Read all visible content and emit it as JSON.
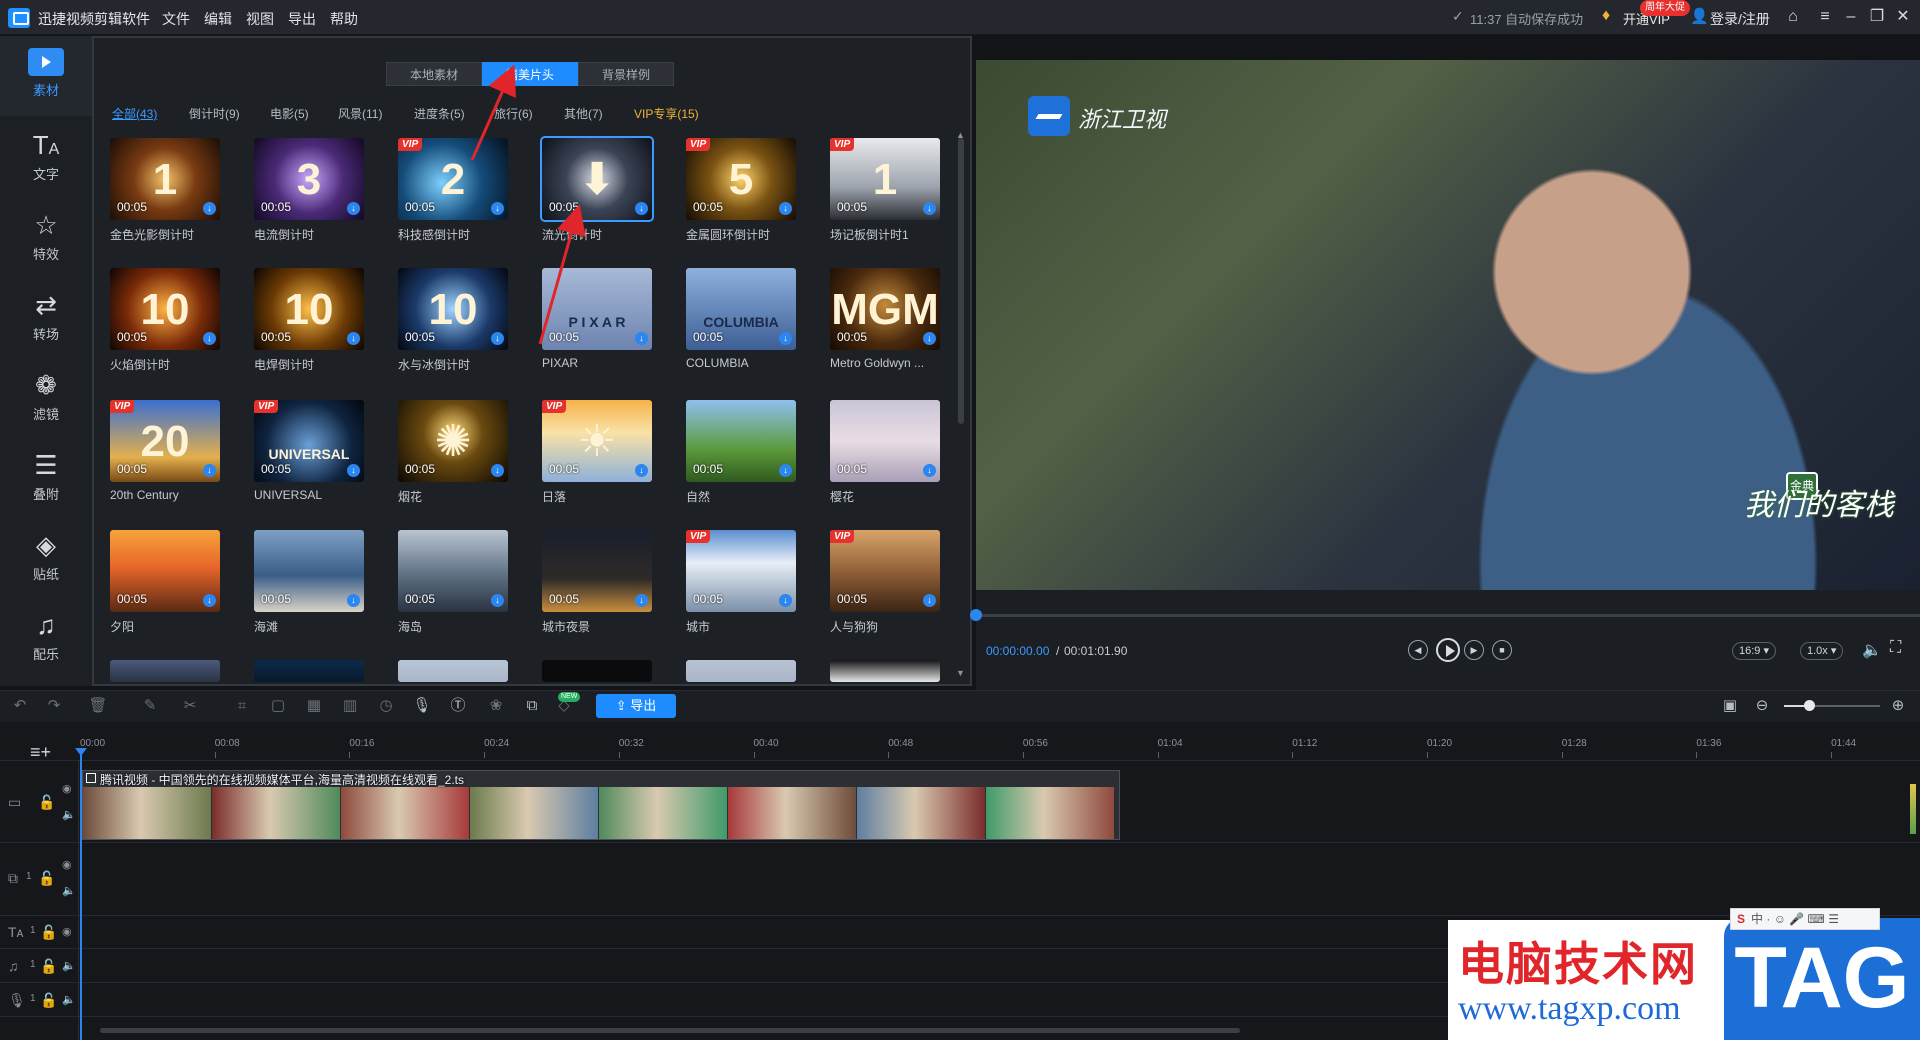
{
  "app": {
    "title": "迅捷视频剪辑软件"
  },
  "menu": [
    "文件",
    "编辑",
    "视图",
    "导出",
    "帮助"
  ],
  "status": {
    "autosave": "11:37 自动保存成功",
    "vip": "开通VIP",
    "promo_badge": "周年大促",
    "login": "登录/注册"
  },
  "rail": [
    {
      "label": "素材",
      "icon": "play-icon"
    },
    {
      "label": "文字",
      "icon": "text-icon"
    },
    {
      "label": "特效",
      "icon": "star-icon"
    },
    {
      "label": "转场",
      "icon": "transition-icon"
    },
    {
      "label": "滤镜",
      "icon": "filter-icon"
    },
    {
      "label": "叠附",
      "icon": "layers-icon"
    },
    {
      "label": "贴纸",
      "icon": "sticker-icon"
    },
    {
      "label": "配乐",
      "icon": "music-note-icon"
    }
  ],
  "tabs": [
    "本地素材",
    "精美片头",
    "背景样例"
  ],
  "categories": [
    "全部(43)",
    "倒计时(9)",
    "电影(5)",
    "风景(11)",
    "进度条(5)",
    "旅行(6)",
    "其他(7)",
    "VIP专享(15)"
  ],
  "thumbnails": [
    {
      "name": "金色光影倒计时",
      "duration": "00:05",
      "vip": false,
      "glyph": "1"
    },
    {
      "name": "电流倒计时",
      "duration": "00:05",
      "vip": false,
      "glyph": "3"
    },
    {
      "name": "科技感倒计时",
      "duration": "00:05",
      "vip": true,
      "glyph": "2"
    },
    {
      "name": "流光倒计时",
      "duration": "00:05",
      "vip": false,
      "glyph": "⬇"
    },
    {
      "name": "金属圆环倒计时",
      "duration": "00:05",
      "vip": true,
      "glyph": "5"
    },
    {
      "name": "场记板倒计时1",
      "duration": "00:05",
      "vip": true,
      "glyph": "1"
    },
    {
      "name": "火焰倒计时",
      "duration": "00:05",
      "vip": false,
      "glyph": "10"
    },
    {
      "name": "电焊倒计时",
      "duration": "00:05",
      "vip": false,
      "glyph": "10"
    },
    {
      "name": "水与冰倒计时",
      "duration": "00:05",
      "vip": false,
      "glyph": "10"
    },
    {
      "name": "PIXAR",
      "duration": "00:05",
      "vip": false,
      "glyph": "P I X A R"
    },
    {
      "name": "COLUMBIA",
      "duration": "00:05",
      "vip": false,
      "glyph": "COLUMBIA"
    },
    {
      "name": "Metro Goldwyn ...",
      "duration": "00:05",
      "vip": false,
      "glyph": "MGM"
    },
    {
      "name": "20th Century",
      "duration": "00:05",
      "vip": true,
      "glyph": "20"
    },
    {
      "name": "UNIVERSAL",
      "duration": "00:05",
      "vip": true,
      "glyph": "UNIVERSAL"
    },
    {
      "name": "烟花",
      "duration": "00:05",
      "vip": false,
      "glyph": "✺"
    },
    {
      "name": "日落",
      "duration": "00:05",
      "vip": true,
      "glyph": "☀"
    },
    {
      "name": "自然",
      "duration": "00:05",
      "vip": false,
      "glyph": ""
    },
    {
      "name": "樱花",
      "duration": "00:05",
      "vip": false,
      "glyph": ""
    },
    {
      "name": "夕阳",
      "duration": "00:05",
      "vip": false,
      "glyph": ""
    },
    {
      "name": "海滩",
      "duration": "00:05",
      "vip": false,
      "glyph": ""
    },
    {
      "name": "海岛",
      "duration": "00:05",
      "vip": false,
      "glyph": ""
    },
    {
      "name": "城市夜景",
      "duration": "00:05",
      "vip": false,
      "glyph": ""
    },
    {
      "name": "城市",
      "duration": "00:05",
      "vip": true,
      "glyph": ""
    },
    {
      "name": "人与狗狗",
      "duration": "00:05",
      "vip": true,
      "glyph": ""
    }
  ],
  "preview": {
    "channel_logo": "浙江卫视",
    "show_logo": "我们的客栈",
    "show_badge": "金典",
    "time_current": "00:00:00.00",
    "time_separator": "/",
    "time_total": "00:01:01.90",
    "aspect": "16:9",
    "speed": "1.0x"
  },
  "toolbar": {
    "export_label": "导出",
    "new_badge": "NEW"
  },
  "timeline": {
    "ticks": [
      "00:00",
      "00:08",
      "00:16",
      "00:24",
      "00:32",
      "00:40",
      "00:48",
      "00:56",
      "01:04",
      "01:12",
      "01:20",
      "01:28",
      "01:36",
      "01:44"
    ],
    "clip_title": "腾讯视频 - 中国领先的在线视频媒体平台,海量高清视频在线观看_2.ts",
    "track_index": "1"
  },
  "watermark": {
    "site_name": "电脑技术网",
    "url": "www.tagxp.com",
    "tag": "TAG",
    "ime_label": "中"
  },
  "colors": {
    "accent": "#1e8cff",
    "vip": "#e5322d",
    "vip_text": "#f0b33a",
    "annotation_arrow": "#e0262b"
  }
}
